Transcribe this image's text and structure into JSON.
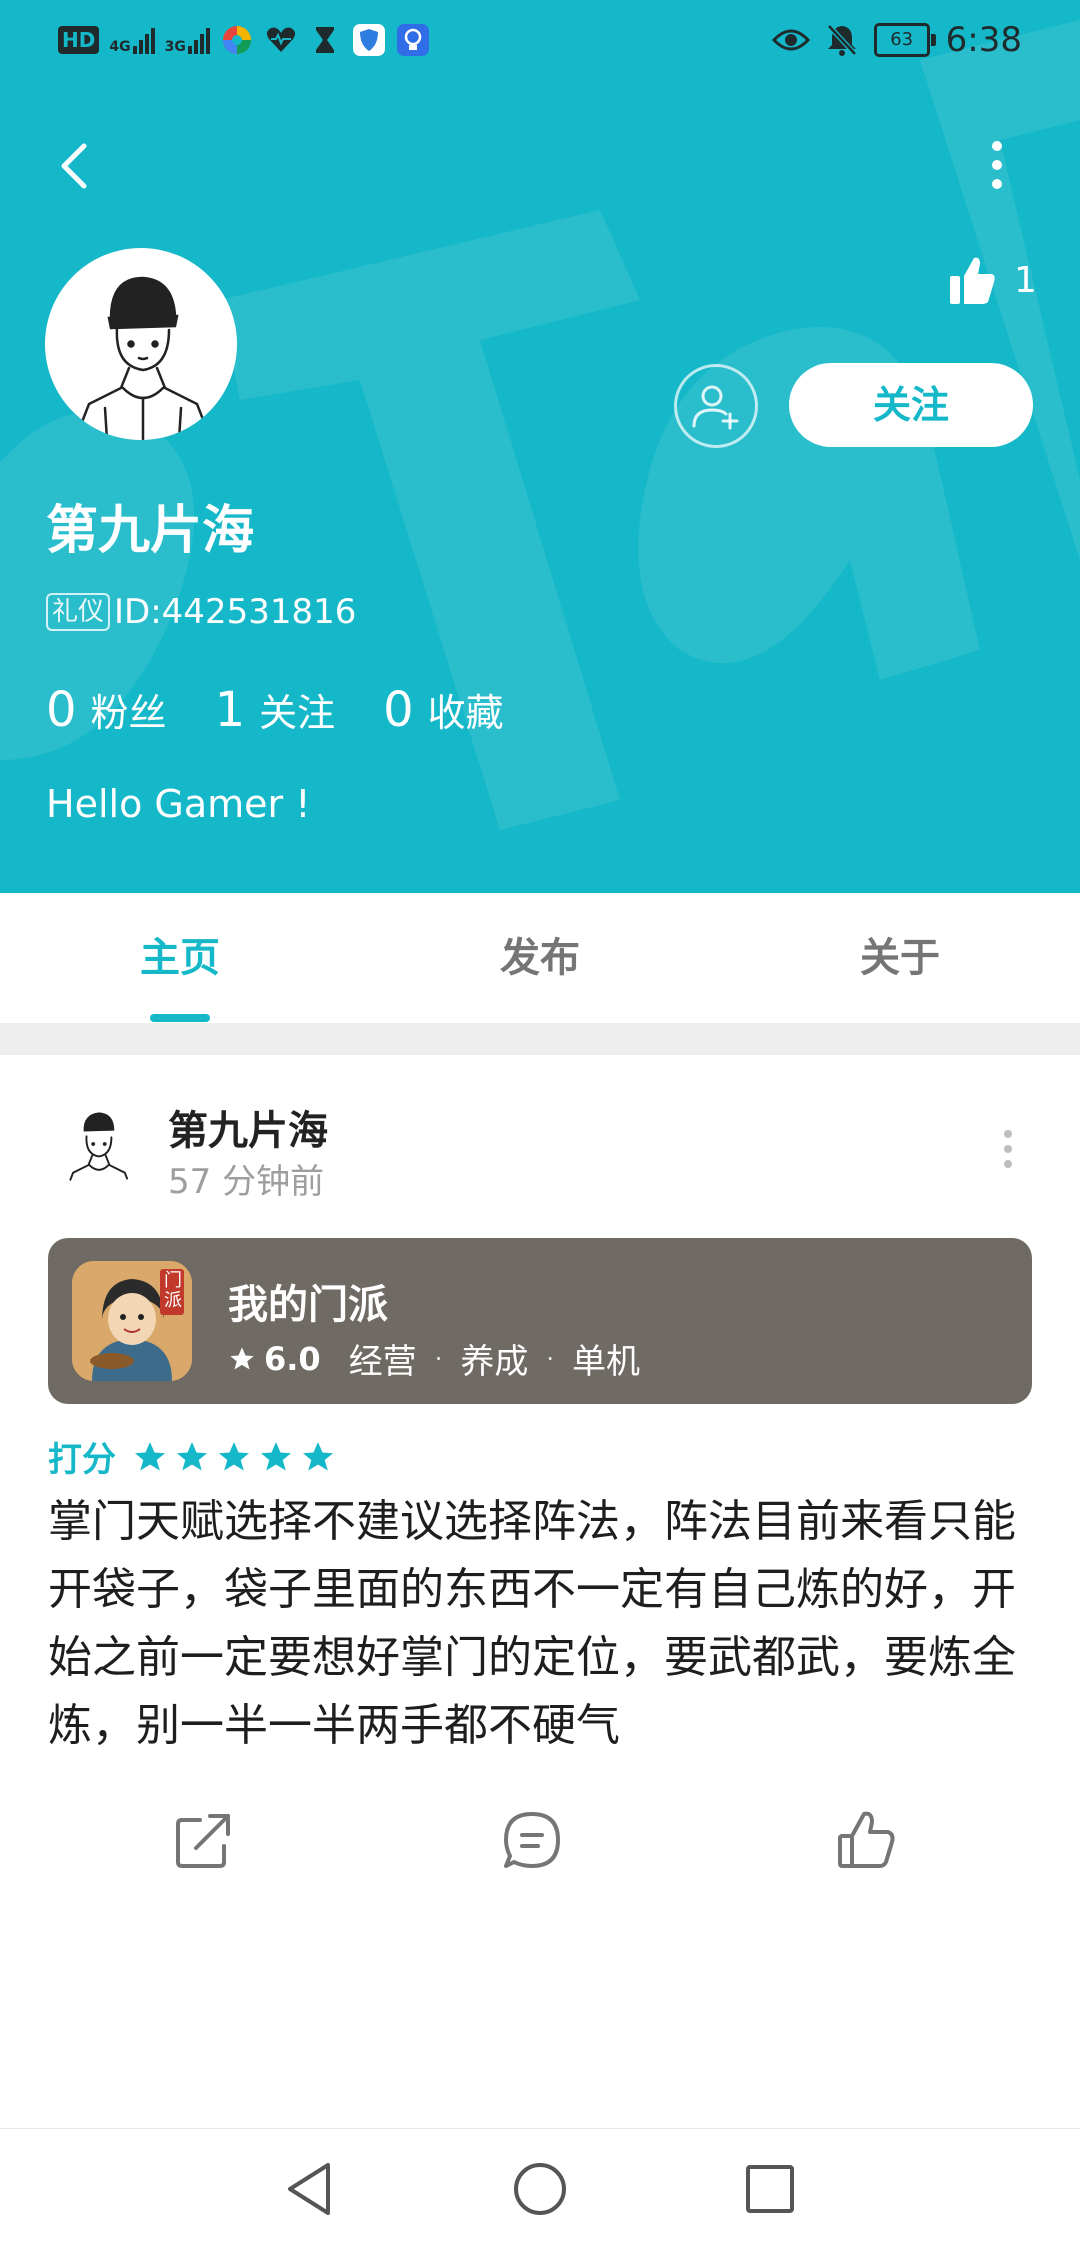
{
  "status_bar": {
    "network_chip": "HD",
    "signal_1": "4G",
    "signal_2": "3G",
    "battery": "63",
    "time": "6:38",
    "icons": [
      "eye-icon",
      "bell-off-icon"
    ]
  },
  "profile": {
    "nickname": "第九片海",
    "id_tag": "礼仪",
    "id_text": "ID:442531816",
    "like_count": "1",
    "follow_button": "关注",
    "bio": "Hello Gamer !",
    "stats": [
      {
        "num": "0",
        "label": "粉丝"
      },
      {
        "num": "1",
        "label": "关注"
      },
      {
        "num": "0",
        "label": "收藏"
      }
    ]
  },
  "tabs": [
    {
      "label": "主页",
      "active": true
    },
    {
      "label": "发布",
      "active": false
    },
    {
      "label": "关于",
      "active": false
    }
  ],
  "post": {
    "author": "第九片海",
    "time": "57 分钟前",
    "game": {
      "name": "我的门派",
      "icon_text": "门派",
      "rating": "6.0",
      "tags": [
        "经营",
        "养成",
        "单机"
      ]
    },
    "rating_label": "打分",
    "stars": 5,
    "content": "掌门天赋选择不建议选择阵法，阵法目前来看只能开袋子，袋子里面的东西不一定有自己炼的好，开始之前一定要想好掌门的定位，要武都武，要炼全炼，别一半一半两手都不硬气"
  },
  "colors": {
    "accent": "#15b8c8",
    "game_card": "#6f6a63"
  }
}
